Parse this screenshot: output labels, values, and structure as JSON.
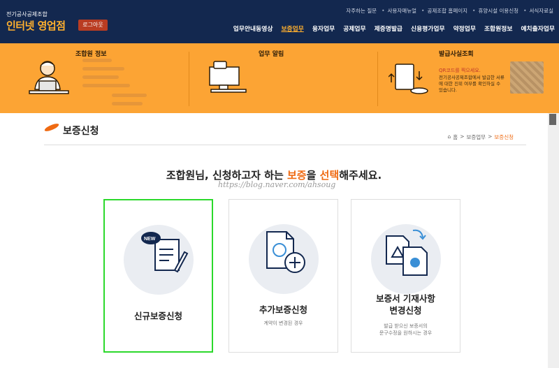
{
  "brand": {
    "org": "전기공사공제조합",
    "title": "인터넷 영업점"
  },
  "logout_label": "로그아웃",
  "util_links": [
    "자주하는 질문",
    "사용자매뉴얼",
    "공제조합 홈페이지",
    "휴양시설 이용신청",
    "서식자료실"
  ],
  "gnb": [
    "업무안내동영상",
    "보증업무",
    "융자업무",
    "공제업무",
    "제증명발급",
    "신용평가업무",
    "약정업무",
    "조합원정보",
    "예치출자업무"
  ],
  "gnb_active": "보증업무",
  "banner": {
    "member_title": "조합원 정보",
    "notice_title": "업무 알림",
    "issue_title": "발급사실조회",
    "qr_heading": "QR코드를 찍으세요.",
    "qr_text": "전기공사공제조합에서 발급한 서류에 대한 진위 여부를 확인하실 수 있습니다."
  },
  "page_title": "보증신청",
  "breadcrumb": [
    "홈",
    "보증업무",
    "보증신청"
  ],
  "headline": {
    "pre": "조합원님, 신청하고자 하는 ",
    "w1": "보증",
    "mid": "을 ",
    "w2": "선택",
    "post": "해주세요."
  },
  "watermark": "https://blog.naver.com/ahsoug",
  "cards": [
    {
      "title": "신규보증신청",
      "sub": "",
      "icon": "new-document-icon",
      "selected": true
    },
    {
      "title": "추가보증신청",
      "sub": "계약이 변경된 경우",
      "icon": "add-document-icon",
      "selected": false
    },
    {
      "title1": "보증서 기재사항",
      "title2": "변경신청",
      "sub1": "발급 받으신 보증서의",
      "sub2": "문구수정을 원하시는 경우",
      "icon": "change-document-icon",
      "selected": false
    }
  ],
  "colors": {
    "navy": "#13284f",
    "orange": "#fca434",
    "accent": "#ef6a12",
    "selection": "#2bd92b"
  }
}
